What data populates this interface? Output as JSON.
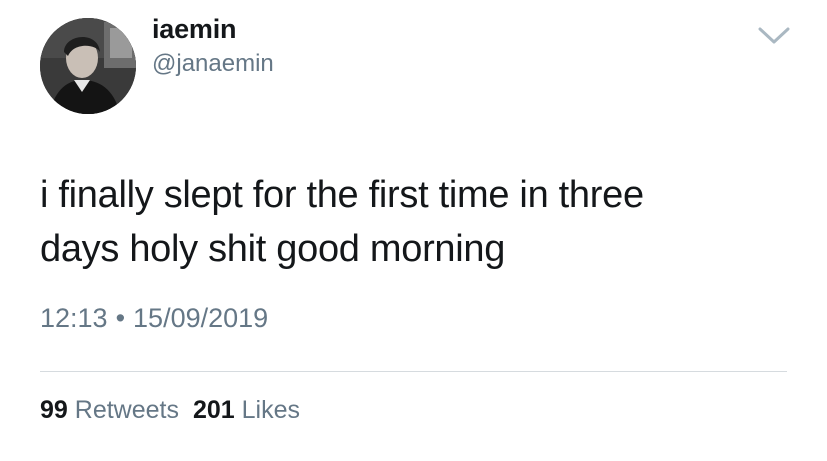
{
  "tweet": {
    "user": {
      "display_name": "iaemin",
      "handle": "@janaemin"
    },
    "text_lines": [
      "i finally slept for the first time in three",
      "days holy shit good morning"
    ],
    "time": "12:13",
    "separator": "•",
    "date": "15/09/2019",
    "stats": {
      "retweets_count": "99",
      "retweets_label": "Retweets",
      "likes_count": "201",
      "likes_label": "Likes"
    }
  },
  "icons": {
    "menu": "chevron-down-icon"
  },
  "colors": {
    "text_primary": "#14171a",
    "text_secondary": "#657786",
    "divider": "#d6dbdf",
    "background": "#ffffff"
  }
}
